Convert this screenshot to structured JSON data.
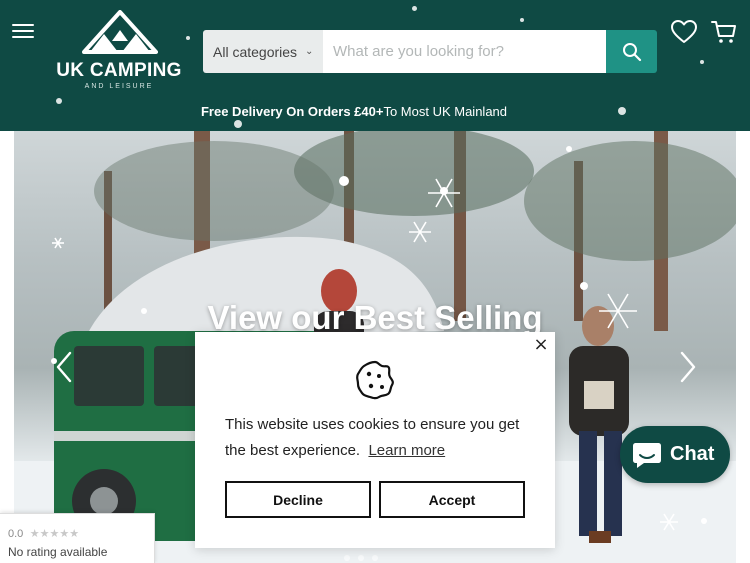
{
  "colors": {
    "header_bg": "#0f4a44",
    "search_button": "#1f9285",
    "chat_bg": "#0f4a44"
  },
  "header": {
    "menu_icon": "hamburger-icon",
    "logo": {
      "name": "UK CAMPING",
      "tagline": "AND LEISURE"
    },
    "search": {
      "category_selected": "All categories",
      "placeholder": "What are you looking for?",
      "button_icon": "search-icon"
    },
    "wishlist_icon": "heart-icon",
    "cart_icon": "cart-icon",
    "promo": {
      "bold": "Free Delivery On Orders £40+",
      "rest": "To Most UK Mainland"
    }
  },
  "hero": {
    "title": "View our Best Selling",
    "prev_icon": "chevron-left-icon",
    "next_icon": "chevron-right-icon"
  },
  "cookie_banner": {
    "icon": "cookie-icon",
    "message": "This website uses cookies to ensure you get the best experience.",
    "learn_more": "Learn more",
    "decline": "Decline",
    "accept": "Accept",
    "close_symbol": "×"
  },
  "chat": {
    "label": "Chat",
    "icon": "chat-bubble-icon"
  },
  "rating_badge": {
    "score": "0.0",
    "stars": "★★★★★",
    "text": "No rating available"
  }
}
